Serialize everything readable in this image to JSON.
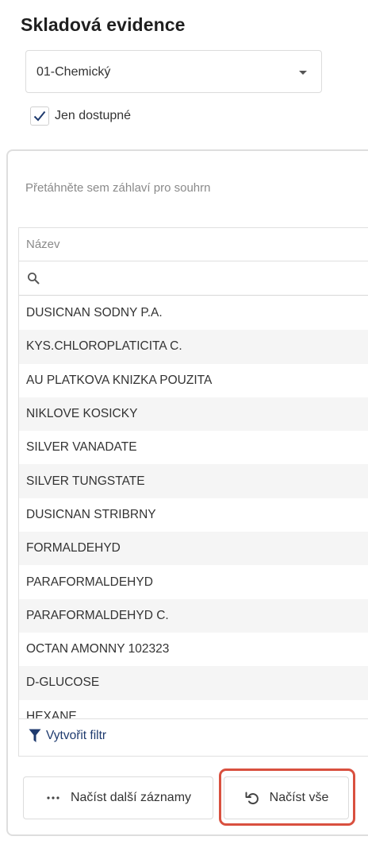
{
  "page": {
    "title": "Skladová evidence"
  },
  "warehouse_select": {
    "value": "01-Chemický"
  },
  "available_only": {
    "label": "Jen dostupné",
    "checked": true
  },
  "grid": {
    "group_hint": "Přetáhněte sem záhlaví pro souhrn",
    "column_header": "Název",
    "search_value": "",
    "rows": [
      "DUSICNAN SODNY P.A.",
      "KYS.CHLOROPLATICITA C.",
      "AU PLATKOVA KNIZKA POUZITA",
      "NIKLOVE KOSICKY",
      "SILVER VANADATE",
      "SILVER TUNGSTATE",
      "DUSICNAN STRIBRNY",
      "FORMALDEHYD",
      "PARAFORMALDEHYD",
      "PARAFORMALDEHYD C.",
      "OCTAN AMONNY 102323",
      "D-GLUCOSE",
      "HEXANE"
    ],
    "create_filter_label": "Vytvořit filtr"
  },
  "buttons": {
    "load_more_label": "Načíst další záznamy",
    "load_all_label": "Načíst vše"
  },
  "icons": {
    "select_arrow": "chevron-down-icon",
    "checkbox": "checkmark-icon",
    "search": "search-icon",
    "filter": "funnel-icon",
    "load_more": "ellipsis-icon",
    "load_all": "undo-icon"
  },
  "colors": {
    "accent_text": "#1e3a6e",
    "checkmark": "#1e3a6e",
    "highlight": "#d9503f",
    "stripe": "#f5f5f5"
  }
}
